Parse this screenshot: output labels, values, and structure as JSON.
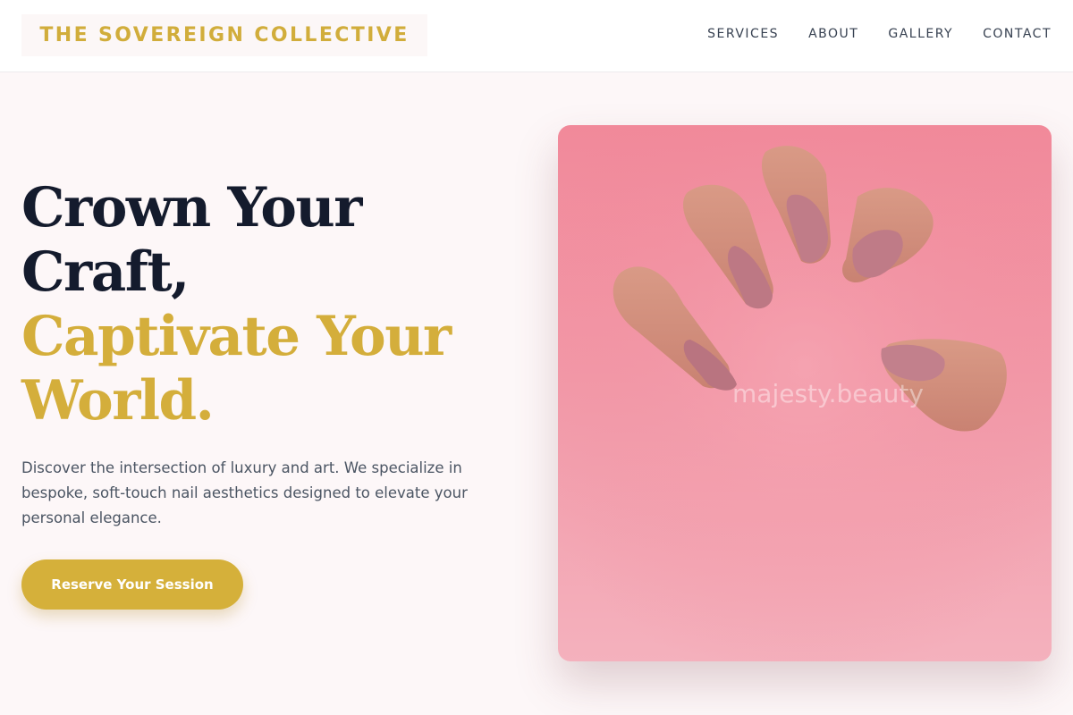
{
  "brand": {
    "name": "THE SOVEREIGN COLLECTIVE"
  },
  "nav": {
    "items": [
      {
        "label": "SERVICES"
      },
      {
        "label": "ABOUT"
      },
      {
        "label": "GALLERY"
      },
      {
        "label": "CONTACT"
      }
    ]
  },
  "hero": {
    "title_line1": "Crown Your",
    "title_line2": "Craft,",
    "title_line3": "Captivate Your",
    "title_line4": "World.",
    "description": "Discover the intersection of luxury and art. We specialize in bespoke, soft-touch nail aesthetics designed to elevate your personal elegance.",
    "cta_label": "Reserve Your Session",
    "image_watermark": "majesty.beauty"
  },
  "colors": {
    "accent_gold": "#d4ae3b",
    "heading_dark": "#141b2d",
    "background": "#fdf7f8",
    "image_pink": "#f298a7"
  }
}
